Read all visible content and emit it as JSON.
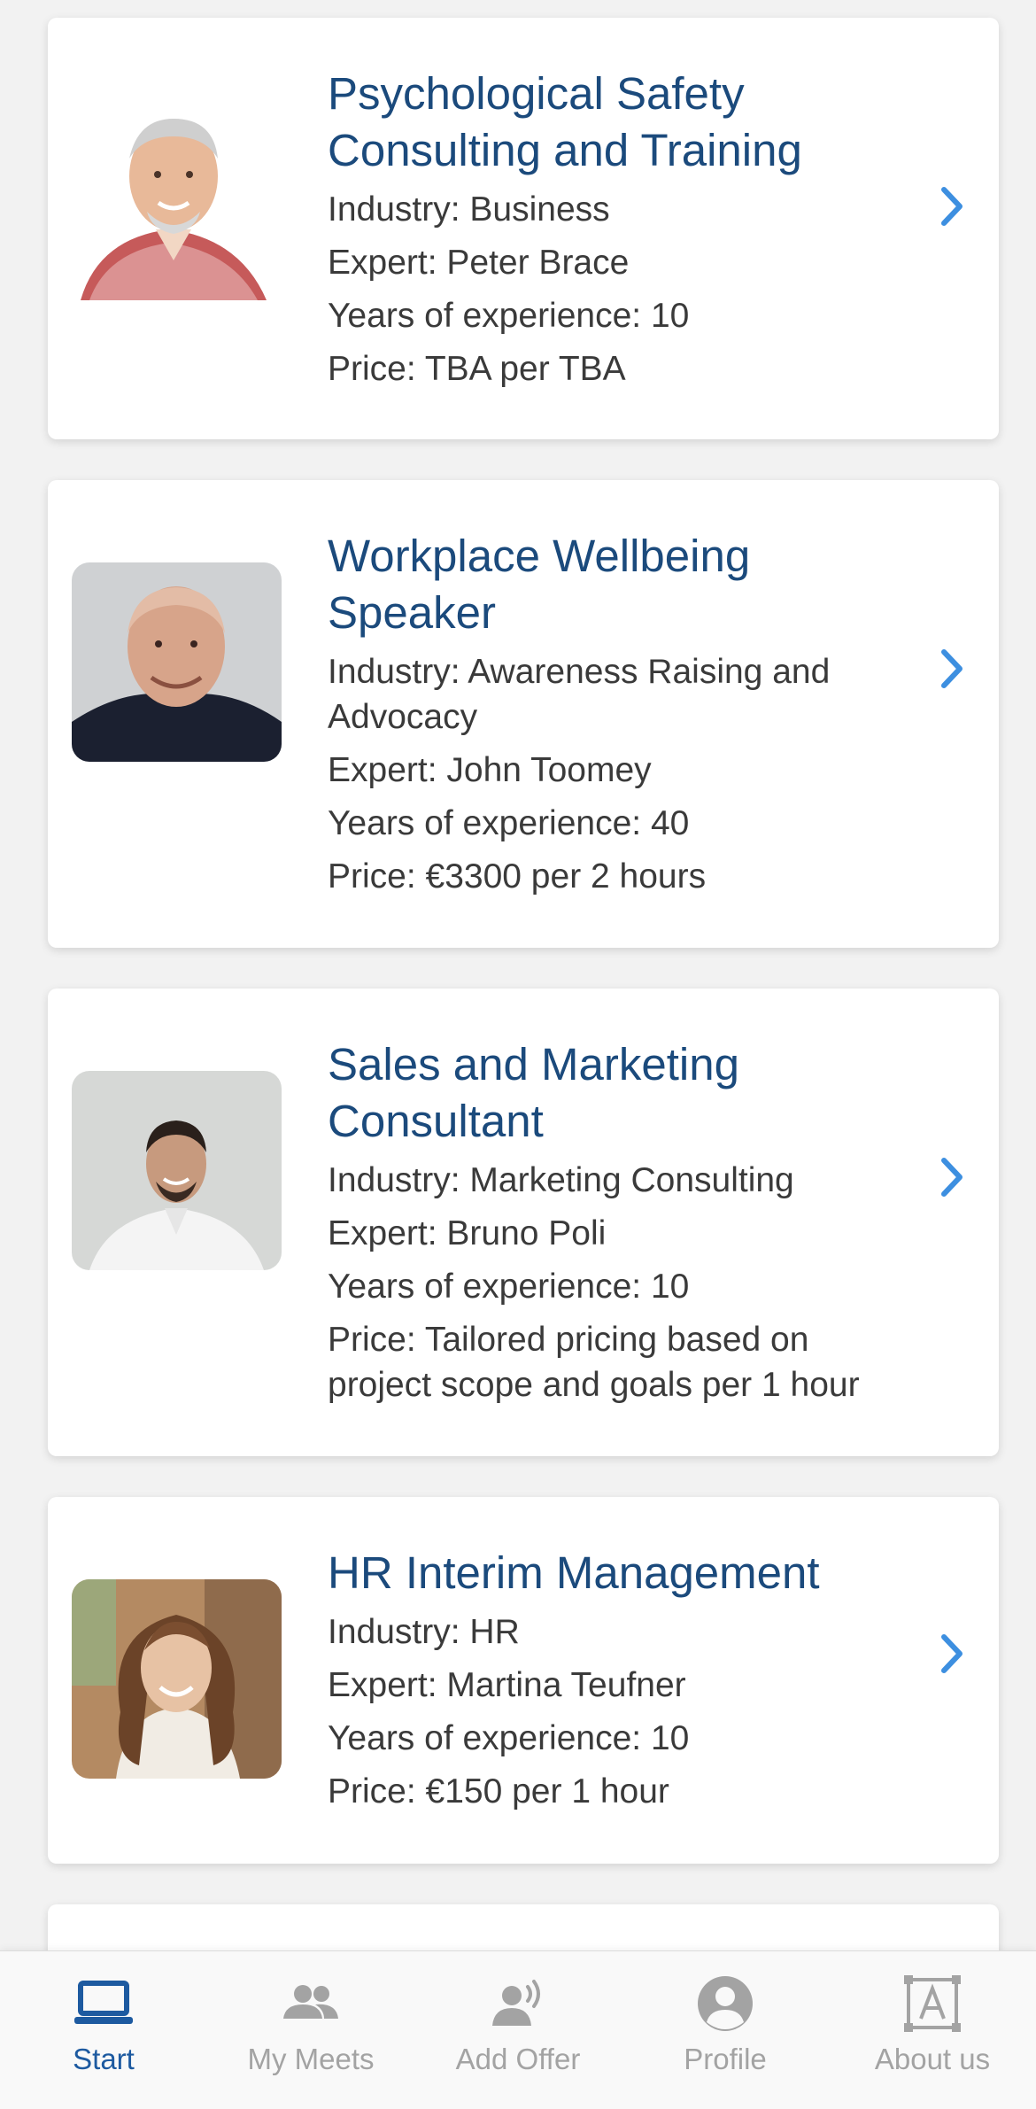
{
  "offers": [
    {
      "title_lines": [
        "Psychological Safety",
        "Consulting and Training"
      ],
      "industry_lines": [
        "Industry: Business"
      ],
      "expert": "Expert: Peter Brace",
      "experience": "Years of experience: 10",
      "price_lines": [
        "Price: TBA per TBA"
      ],
      "photo": "photo-older-man-checked-shirt"
    },
    {
      "title_lines": [
        "Workplace Wellbeing",
        "Speaker"
      ],
      "industry_lines": [
        "Industry: Awareness Raising and",
        "Advocacy"
      ],
      "expert": "Expert: John Toomey",
      "experience": "Years of experience: 40",
      "price_lines": [
        "Price: €3300 per 2 hours"
      ],
      "photo": "photo-bald-man-dark-shirt"
    },
    {
      "title_lines": [
        "Sales and Marketing",
        "Consultant"
      ],
      "industry_lines": [
        "Industry: Marketing Consulting"
      ],
      "expert": "Expert: Bruno Poli",
      "experience": "Years of experience: 10",
      "price_lines": [
        "Price: Tailored pricing based on",
        "project scope and goals per 1 hour"
      ],
      "photo": "photo-young-man-white-shirt"
    },
    {
      "title_lines": [
        "HR Interim Management"
      ],
      "industry_lines": [
        "Industry: HR"
      ],
      "expert": "Expert: Martina Teufner",
      "experience": "Years of experience: 10",
      "price_lines": [
        "Price: €150 per 1 hour"
      ],
      "photo": "photo-woman-curly-hair"
    }
  ],
  "tabs": [
    {
      "label": "Start",
      "icon": "laptop-icon",
      "active": true
    },
    {
      "label": "My Meets",
      "icon": "people-icon",
      "active": false
    },
    {
      "label": "Add Offer",
      "icon": "speaker-person-icon",
      "active": false
    },
    {
      "label": "Profile",
      "icon": "profile-icon",
      "active": false
    },
    {
      "label": "About us",
      "icon": "about-us-icon",
      "active": false
    }
  ],
  "colors": {
    "title": "#1b4a7c",
    "text": "#3a3a3a",
    "chevron": "#3d8fe0",
    "tab_active": "#1d5aa0",
    "tab_inactive": "#a3a3a3"
  }
}
